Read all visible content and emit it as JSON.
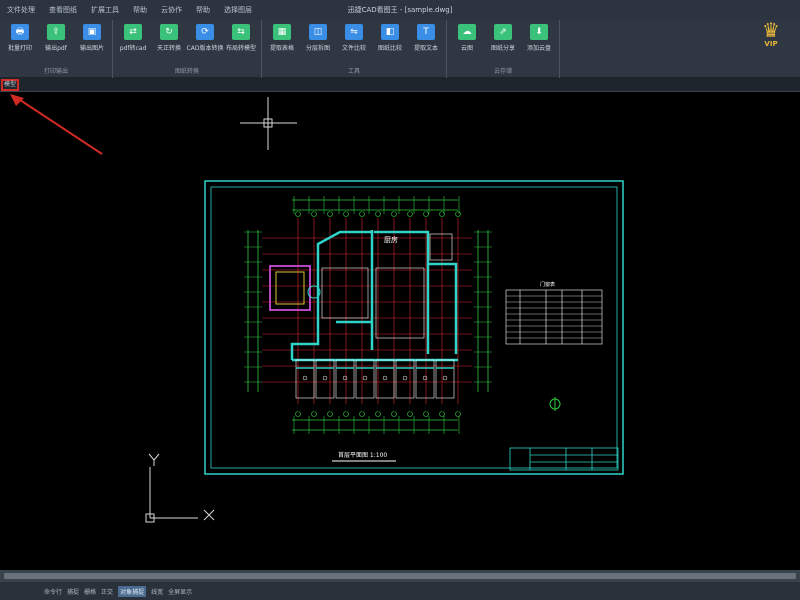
{
  "menubar": {
    "title": "迅捷CAD看图王 - [sample.dwg]",
    "items": [
      "文件处理",
      "查看图纸",
      "扩展工具",
      "帮助",
      "云协作",
      "帮助",
      "选择图层"
    ]
  },
  "ribbon": {
    "groups": [
      {
        "title": "打印输出",
        "buttons": [
          {
            "label": "批量打印",
            "icon": "printer-icon",
            "glyph": "🖶",
            "color": "#3a8ee6"
          },
          {
            "label": "输出pdf",
            "icon": "pdf-export-icon",
            "glyph": "⇪",
            "color": "#3ac27a"
          },
          {
            "label": "输出图片",
            "icon": "image-export-icon",
            "glyph": "▣",
            "color": "#3a8ee6"
          }
        ]
      },
      {
        "title": "图纸转换",
        "buttons": [
          {
            "label": "pdf转cad",
            "icon": "pdf-to-cad-icon",
            "glyph": "⇄",
            "color": "#3ac27a"
          },
          {
            "label": "天正转换",
            "icon": "tangent-convert-icon",
            "glyph": "↻",
            "color": "#3ac27a"
          },
          {
            "label": "CAD版本转换",
            "icon": "cad-version-icon",
            "glyph": "⟳",
            "color": "#3a8ee6"
          },
          {
            "label": "布局转模型",
            "icon": "layout-to-model-icon",
            "glyph": "⇆",
            "color": "#3ac27a"
          }
        ]
      },
      {
        "title": "工具",
        "buttons": [
          {
            "label": "提取表格",
            "icon": "table-extract-icon",
            "glyph": "▦",
            "color": "#3ac27a"
          },
          {
            "label": "分层拆图",
            "icon": "layer-split-icon",
            "glyph": "◫",
            "color": "#3a8ee6"
          },
          {
            "label": "文件比较",
            "icon": "file-compare-icon",
            "glyph": "⇋",
            "color": "#3a8ee6"
          },
          {
            "label": "图纸比较",
            "icon": "drawing-compare-icon",
            "glyph": "◧",
            "color": "#3a8ee6"
          },
          {
            "label": "提取文本",
            "icon": "text-extract-icon",
            "glyph": "T",
            "color": "#3a8ee6"
          }
        ]
      },
      {
        "title": "云存储",
        "buttons": [
          {
            "label": "云图",
            "icon": "cloud-icon",
            "glyph": "☁",
            "color": "#3ac27a"
          },
          {
            "label": "图纸分享",
            "icon": "share-icon",
            "glyph": "⇗",
            "color": "#3ac27a"
          },
          {
            "label": "添加云盘",
            "icon": "cloud-drive-icon",
            "glyph": "⬇",
            "color": "#3ac27a"
          }
        ]
      }
    ],
    "vip_label": "VIP"
  },
  "tabstrip": {
    "tab_label": "模型"
  },
  "drawing": {
    "title_text": "首层平面图 1:100",
    "table_header": "门窗表",
    "room_label": "厨房"
  },
  "statusbar": {
    "items": [
      "命令行",
      "捕捉",
      "栅格",
      "正交",
      "对象捕捉",
      "线宽",
      "全屏显示"
    ],
    "active_index": 4
  },
  "colors": {
    "frame": "#2fd3c8",
    "grid": "#ff3030",
    "green": "#2ecc40",
    "magenta": "#c84bd6",
    "cursor": "#d8d8d8"
  }
}
